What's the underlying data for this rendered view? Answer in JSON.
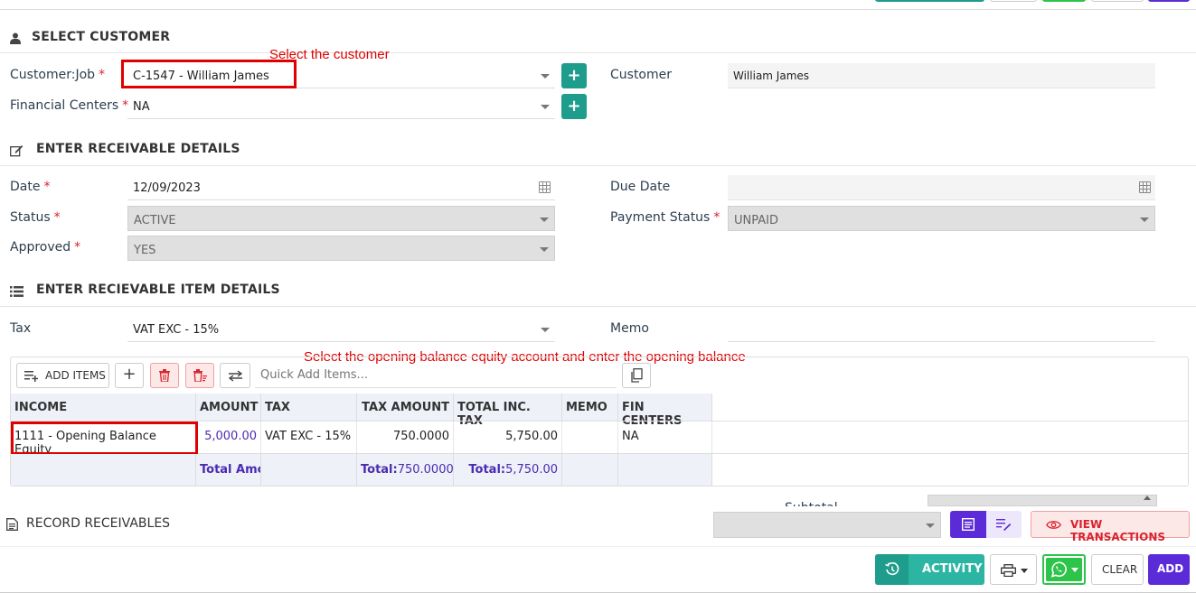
{
  "select_customer": {
    "title": "SELECT CUSTOMER",
    "customer_job_label": "Customer:Job",
    "customer_job_value": "C-1547 - William James",
    "financial_centers_label": "Financial Centers",
    "financial_centers_value": "NA",
    "customer_label": "Customer",
    "customer_value": "William James",
    "annotation": "Select the customer"
  },
  "receivable_details": {
    "title": "ENTER RECEIVABLE DETAILS",
    "date_label": "Date",
    "date_value": "12/09/2023",
    "due_date_label": "Due Date",
    "due_date_value": "",
    "status_label": "Status",
    "status_value": "ACTIVE",
    "payment_status_label": "Payment Status",
    "payment_status_value": "UNPAID",
    "approved_label": "Approved",
    "approved_value": "YES"
  },
  "item_details": {
    "title": "ENTER RECIEVABLE ITEM DETAILS",
    "tax_label": "Tax",
    "tax_value": "VAT EXC - 15%",
    "memo_label": "Memo",
    "memo_value": "",
    "annotation": "Select the opening balance equity account and enter the opening balance",
    "toolbar": {
      "add_items_label": "ADD ITEMS",
      "quick_add_placeholder": "Quick Add Items..."
    },
    "columns": [
      "INCOME",
      "AMOUNT",
      "TAX",
      "TAX AMOUNT",
      "TOTAL INC. TAX",
      "MEMO",
      "FIN CENTERS"
    ],
    "row": {
      "income": "1111 - Opening Balance Equity",
      "amount": "5,000.00",
      "tax": "VAT EXC - 15%",
      "tax_amount": "750.0000",
      "total_inc_tax": "5,750.00",
      "memo": "",
      "fin_centers": "NA"
    },
    "footer": {
      "total_amount_label": "Total Amc",
      "total_tax_label": "Total:",
      "total_tax_value": "750.0000",
      "total_inc_label": "Total:",
      "total_inc_value": "5,750.00"
    }
  },
  "record_receivables": {
    "title": "RECORD RECEIVABLES",
    "subtotal_label": "Subtotal",
    "view_transactions_label": "VIEW TRANSACTIONS"
  },
  "actions": {
    "activity_label": "ACTIVITY",
    "clear_label": "CLEAR",
    "add_label": "ADD"
  },
  "colors": {
    "teal": "#1e9c8c",
    "purple": "#5b2bd8",
    "red_annotation": "#e00000",
    "whatsapp_green": "#2dc44a"
  }
}
